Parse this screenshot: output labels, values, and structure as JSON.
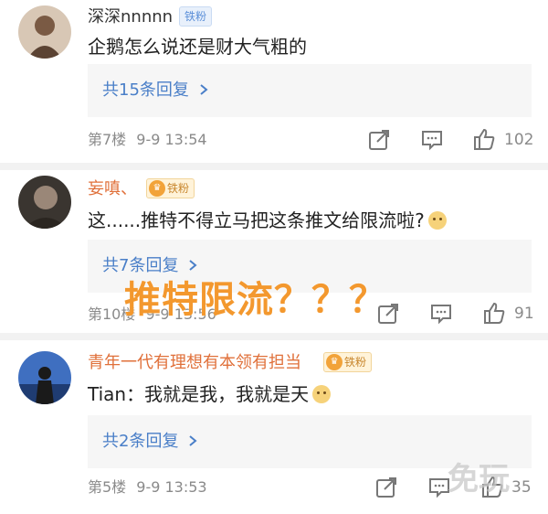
{
  "colors": {
    "accent": "#4a7fc8",
    "username_orange": "#e0703a",
    "overlay_orange": "#f3982e",
    "meta_gray": "#8a8a8a"
  },
  "comments": [
    {
      "username": "深深nnnnn",
      "badge": "铁粉",
      "text": "企鹅怎么说还是财大气粗的",
      "replies": "共15条回复",
      "floor": "第7楼",
      "time": "9-9 13:54",
      "likes": "102"
    },
    {
      "username": "妄嗔、",
      "badge": "铁粉",
      "text": "这......推特不得立马把这条推文给限流啦?",
      "replies": "共7条回复",
      "floor": "第10楼",
      "time": "9-9 13:56",
      "likes": "91"
    },
    {
      "username": "青年一代有理想有本领有担当",
      "badge": "铁粉",
      "text": "Tian：我就是我，我就是天",
      "replies": "共2条回复",
      "floor": "第5楼",
      "time": "9-9 13:53",
      "likes": "35"
    }
  ],
  "overlay_text": "推特限流？？？",
  "watermark": "免玩"
}
